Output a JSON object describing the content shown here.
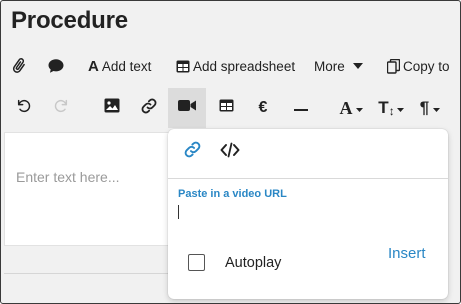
{
  "page": {
    "title": "Procedure"
  },
  "toolbar1": {
    "add_text": "Add text",
    "add_spreadsheet": "Add spreadsheet",
    "more": "More",
    "copy_to": "Copy to"
  },
  "toolbar2": {
    "euro_symbol": "€",
    "font_symbol": "A",
    "size_symbol": "T",
    "paragraph_symbol": "¶",
    "active_tool": "video"
  },
  "editor": {
    "placeholder": "Enter text here..."
  },
  "video_popup": {
    "url_label": "Paste in a video URL",
    "url_value": "",
    "autoplay_label": "Autoplay",
    "autoplay_checked": false,
    "insert_label": "Insert",
    "active_tab": "link"
  },
  "colors": {
    "accent": "#2a87c5",
    "active_button_bg": "#dcdcdc",
    "toolbar_bg": "#f1f1f1"
  }
}
